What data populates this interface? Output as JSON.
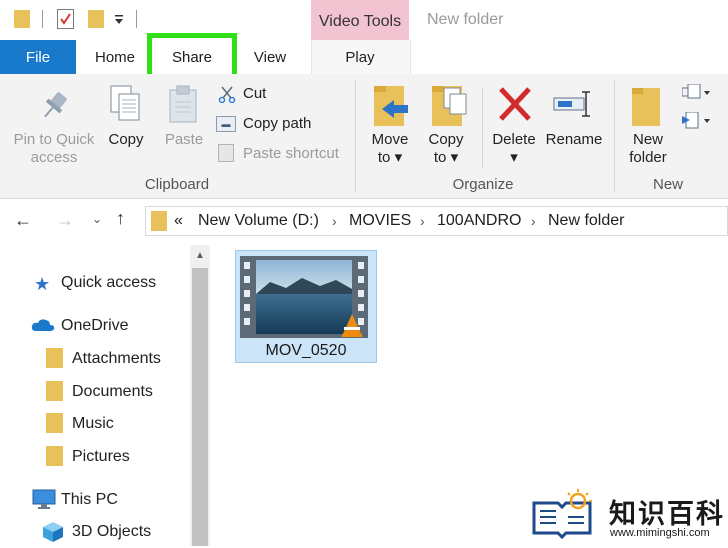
{
  "titlebar": {
    "context_tab_group": "Video Tools",
    "window_title": "New folder"
  },
  "tabs": {
    "file": "File",
    "home": "Home",
    "share": "Share",
    "view": "View",
    "play": "Play"
  },
  "ribbon": {
    "pin_label_1": "Pin to Quick",
    "pin_label_2": "access",
    "copy": "Copy",
    "paste": "Paste",
    "cut": "Cut",
    "copy_path": "Copy path",
    "paste_shortcut": "Paste shortcut",
    "clipboard_group": "Clipboard",
    "move_to_1": "Move",
    "move_to_2": "to",
    "copy_to_1": "Copy",
    "copy_to_2": "to",
    "delete": "Delete",
    "rename": "Rename",
    "organize_group": "Organize",
    "new_folder_1": "New",
    "new_folder_2": "folder",
    "new_group": "New"
  },
  "address": {
    "overflow": "«",
    "crumbs": [
      "New Volume (D:)",
      "MOVIES",
      "100ANDRO",
      "New folder"
    ]
  },
  "nav": {
    "quick_access": "Quick access",
    "onedrive": "OneDrive",
    "folders": [
      "Attachments",
      "Documents",
      "Music",
      "Pictures"
    ],
    "this_pc": "This PC",
    "objects_3d": "3D Objects"
  },
  "files": [
    {
      "name": "MOV_0520",
      "icon": "video-thumbnail-vlc"
    }
  ],
  "watermark": {
    "title": "知识百科",
    "url": "www.mimingshi.com"
  },
  "colors": {
    "file_tab": "#1979ca",
    "highlight": "#2fe016",
    "context_tab": "#f2c4d1",
    "selection": "#cce4f7",
    "delete_red": "#d32a2a"
  }
}
